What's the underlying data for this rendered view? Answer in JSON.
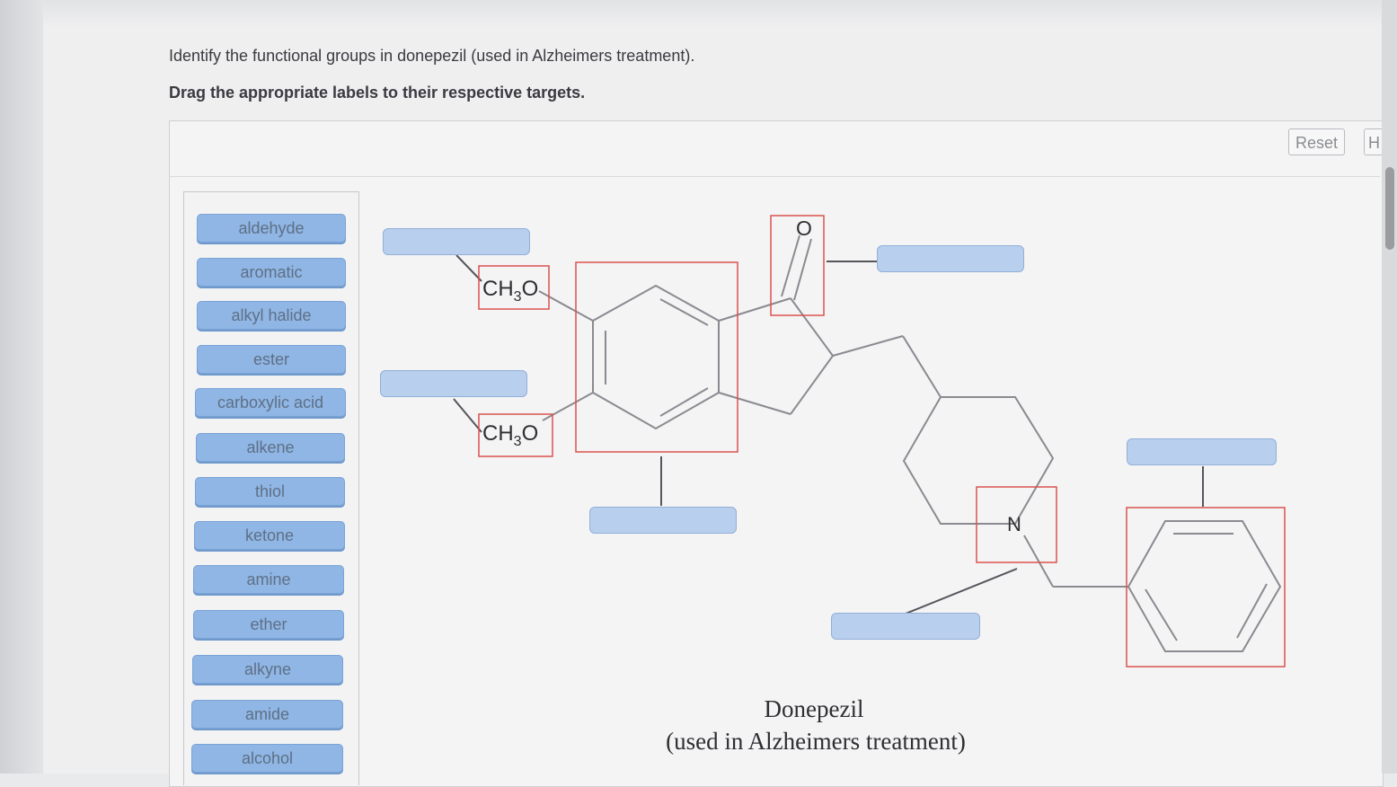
{
  "question": {
    "text": "Identify the functional groups in donepezil (used in Alzheimers treatment).",
    "instruction": "Drag the appropriate labels to their respective targets."
  },
  "toolbar": {
    "reset_label": "Reset",
    "help_label": "H"
  },
  "labels": [
    "aldehyde",
    "aromatic",
    "alkyl halide",
    "ester",
    "carboxylic acid",
    "alkene",
    "thiol",
    "ketone",
    "amine",
    "ether",
    "alkyne",
    "amide",
    "alcohol"
  ],
  "molecule": {
    "methoxy_top": "CH3O",
    "methoxy_bottom": "CH3O",
    "oxygen": "O",
    "nitrogen": "N",
    "name": "Donepezil",
    "subtitle": "(used in Alzheimers treatment)"
  },
  "colors": {
    "label_fill": "#8fb6e4",
    "target_fill": "#b8cfee",
    "highlight_box": "#d9534f"
  }
}
